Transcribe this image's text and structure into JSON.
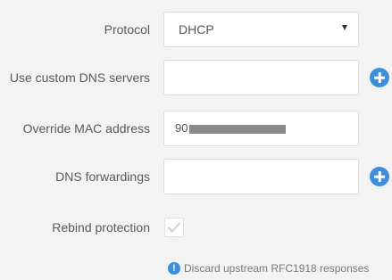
{
  "protocol": {
    "label": "Protocol",
    "selected": "DHCP"
  },
  "custom_dns": {
    "label": "Use custom DNS servers",
    "value": "",
    "add_icon": "plus-circle-icon"
  },
  "override_mac": {
    "label": "Override MAC address",
    "value_visible_prefix": "90:"
  },
  "dns_forwardings": {
    "label": "DNS forwardings",
    "value": "",
    "add_icon": "plus-circle-icon"
  },
  "rebind_protection": {
    "label": "Rebind protection",
    "checked": true,
    "hint": "Discard upstream RFC1918 responses",
    "hint_icon": "info-icon"
  },
  "colors": {
    "accent": "#3e8ee0",
    "background": "#f3f3f3",
    "field_border": "#dcdcdc"
  }
}
